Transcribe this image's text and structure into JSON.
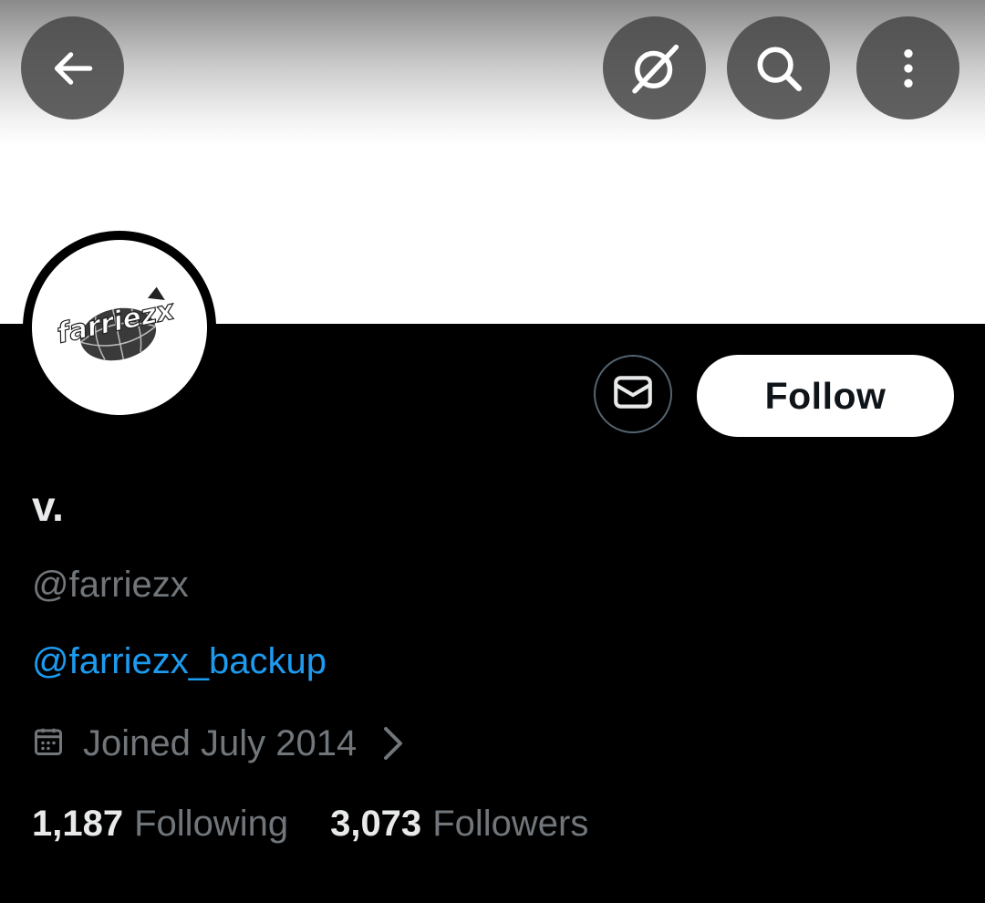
{
  "header": {
    "back_icon": "arrow-left-icon",
    "grok_icon": "grok-icon",
    "search_icon": "search-icon",
    "more_icon": "more-vertical-icon"
  },
  "profile": {
    "avatar_logo_text": "farriezx",
    "display_name": "v.",
    "handle": "@farriezx",
    "bio_link": "@farriezx_backup",
    "joined": "Joined July 2014",
    "following_count": "1,187",
    "following_label": "Following",
    "followers_count": "3,073",
    "followers_label": "Followers"
  },
  "actions": {
    "message_icon": "mail-icon",
    "follow_label": "Follow"
  },
  "colors": {
    "background": "#000000",
    "primary_text": "#e7e9ea",
    "secondary_text": "#71767b",
    "link": "#1d9bf0",
    "follow_bg": "#ffffff"
  }
}
